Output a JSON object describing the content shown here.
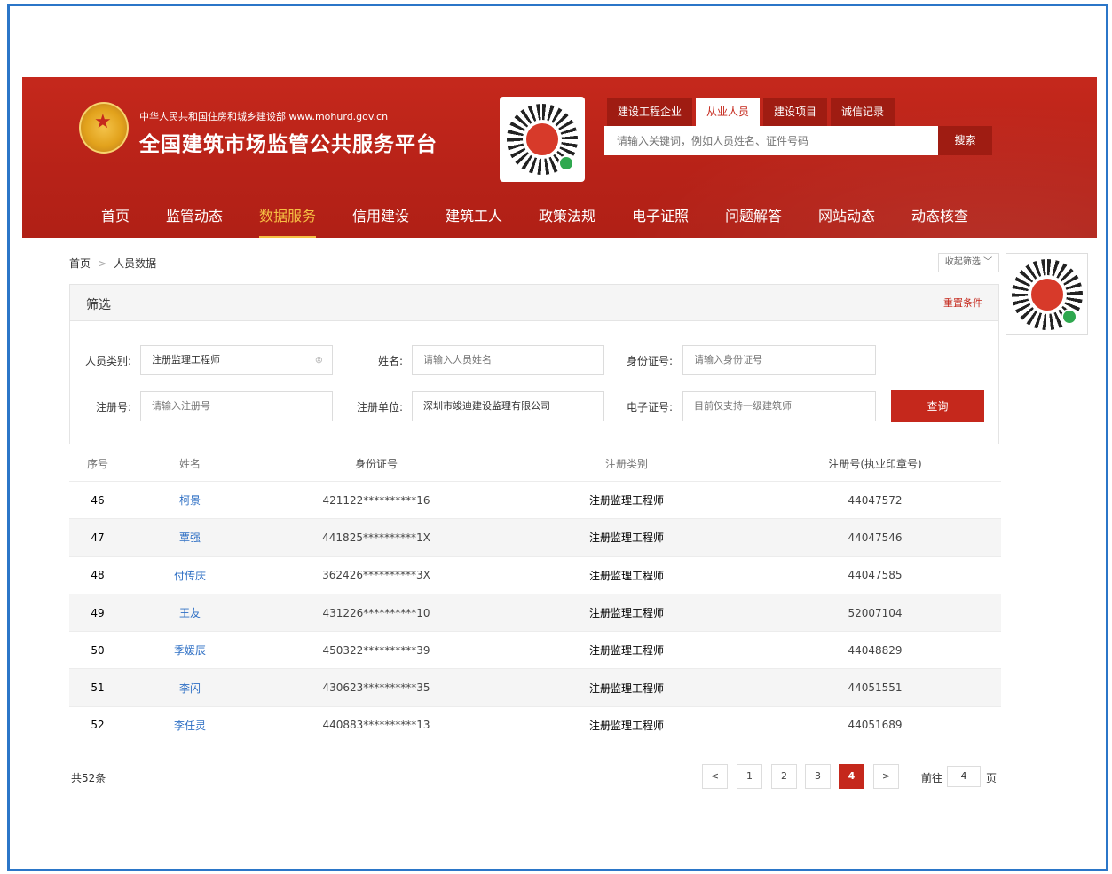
{
  "header": {
    "dept": "中华人民共和国住房和城乡建设部  www.mohurd.gov.cn",
    "title": "全国建筑市场监管公共服务平台",
    "search_tabs": [
      {
        "label": "建设工程企业"
      },
      {
        "label": "从业人员"
      },
      {
        "label": "建设项目"
      },
      {
        "label": "诚信记录"
      }
    ],
    "search_placeholder": "请输入关键词，例如人员姓名、证件号码",
    "search_button": "搜索"
  },
  "nav": [
    {
      "label": "首页"
    },
    {
      "label": "监管动态"
    },
    {
      "label": "数据服务"
    },
    {
      "label": "信用建设"
    },
    {
      "label": "建筑工人"
    },
    {
      "label": "政策法规"
    },
    {
      "label": "电子证照"
    },
    {
      "label": "问题解答"
    },
    {
      "label": "网站动态"
    },
    {
      "label": "动态核查"
    }
  ],
  "breadcrumb": {
    "home": "首页",
    "current": "人员数据",
    "sep": ">"
  },
  "collapse_label": "收起筛选",
  "filter": {
    "title": "筛选",
    "reset": "重置条件",
    "person_type_label": "人员类别:",
    "person_type_value": "注册监理工程师",
    "name_label": "姓名:",
    "name_placeholder": "请输入人员姓名",
    "id_label": "身份证号:",
    "id_placeholder": "请输入身份证号",
    "reg_no_label": "注册号:",
    "reg_no_placeholder": "请输入注册号",
    "reg_unit_label": "注册单位:",
    "reg_unit_value": "深圳市竣迪建设监理有限公司",
    "cert_label": "电子证号:",
    "cert_placeholder": "目前仅支持一级建筑师",
    "query_button": "查询"
  },
  "table": {
    "headers": [
      "序号",
      "姓名",
      "身份证号",
      "注册类别",
      "注册号(执业印章号)"
    ],
    "rows": [
      {
        "no": "46",
        "name": "柯景",
        "id": "421122**********16",
        "type": "注册监理工程师",
        "reg": "44047572"
      },
      {
        "no": "47",
        "name": "覃强",
        "id": "441825**********1X",
        "type": "注册监理工程师",
        "reg": "44047546"
      },
      {
        "no": "48",
        "name": "付传庆",
        "id": "362426**********3X",
        "type": "注册监理工程师",
        "reg": "44047585"
      },
      {
        "no": "49",
        "name": "王友",
        "id": "431226**********10",
        "type": "注册监理工程师",
        "reg": "52007104"
      },
      {
        "no": "50",
        "name": "季媛辰",
        "id": "450322**********39",
        "type": "注册监理工程师",
        "reg": "44048829"
      },
      {
        "no": "51",
        "name": "李闪",
        "id": "430623**********35",
        "type": "注册监理工程师",
        "reg": "44051551"
      },
      {
        "no": "52",
        "name": "李任灵",
        "id": "440883**********13",
        "type": "注册监理工程师",
        "reg": "44051689"
      }
    ]
  },
  "footer": {
    "total": "共52条",
    "pages": [
      "1",
      "2",
      "3",
      "4"
    ],
    "current_page": "4",
    "prev": "<",
    "next": ">",
    "goto_label": "前往",
    "goto_value": "4",
    "page_unit": "页"
  },
  "colors": {
    "brand_red": "#c5281c",
    "link_blue": "#2e6fc4",
    "nav_active": "#f6c043"
  }
}
